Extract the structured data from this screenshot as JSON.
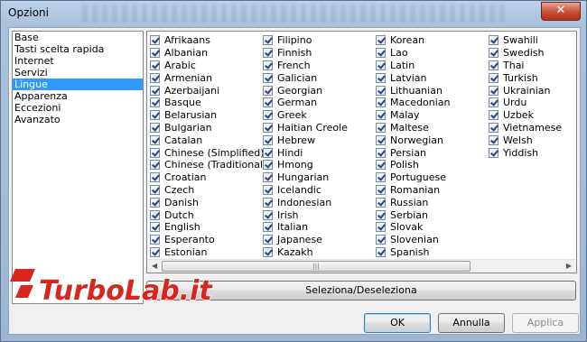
{
  "window": {
    "title": "Opzioni",
    "close_glyph": "✕"
  },
  "sidebar": {
    "items": [
      {
        "label": "Base",
        "selected": false
      },
      {
        "label": "Tasti scelta rapida",
        "selected": false
      },
      {
        "label": "Internet",
        "selected": false
      },
      {
        "label": "Servizi",
        "selected": false
      },
      {
        "label": "Lingue",
        "selected": true
      },
      {
        "label": "Apparenza",
        "selected": false
      },
      {
        "label": "Eccezioni",
        "selected": false
      },
      {
        "label": "Avanzato",
        "selected": false
      }
    ]
  },
  "languages": {
    "columns": [
      [
        "Afrikaans",
        "Albanian",
        "Arabic",
        "Armenian",
        "Azerbaijani",
        "Basque",
        "Belarusian",
        "Bulgarian",
        "Catalan",
        "Chinese (Simplified)",
        "Chinese (Traditional)",
        "Croatian",
        "Czech",
        "Danish",
        "Dutch",
        "English",
        "Esperanto",
        "Estonian"
      ],
      [
        "Filipino",
        "Finnish",
        "French",
        "Galician",
        "Georgian",
        "German",
        "Greek",
        "Haitian Creole",
        "Hebrew",
        "Hindi",
        "Hmong",
        "Hungarian",
        "Icelandic",
        "Indonesian",
        "Irish",
        "Italian",
        "Japanese",
        "Kazakh"
      ],
      [
        "Korean",
        "Lao",
        "Latin",
        "Latvian",
        "Lithuanian",
        "Macedonian",
        "Malay",
        "Maltese",
        "Norwegian",
        "Persian",
        "Polish",
        "Portuguese",
        "Romanian",
        "Russian",
        "Serbian",
        "Slovak",
        "Slovenian",
        "Spanish"
      ],
      [
        "Swahili",
        "Swedish",
        "Thai",
        "Turkish",
        "Ukrainian",
        "Urdu",
        "Uzbek",
        "Vietnamese",
        "Welsh",
        "Yiddish"
      ]
    ],
    "all_checked": true
  },
  "buttons": {
    "select_toggle": "Seleziona/Deseleziona",
    "ok": "OK",
    "cancel": "Annulla",
    "apply": "Applica"
  },
  "watermark": {
    "text": "TurboLab.it"
  },
  "colors": {
    "selection": "#3399ff",
    "watermark_red": "#d7261e"
  }
}
